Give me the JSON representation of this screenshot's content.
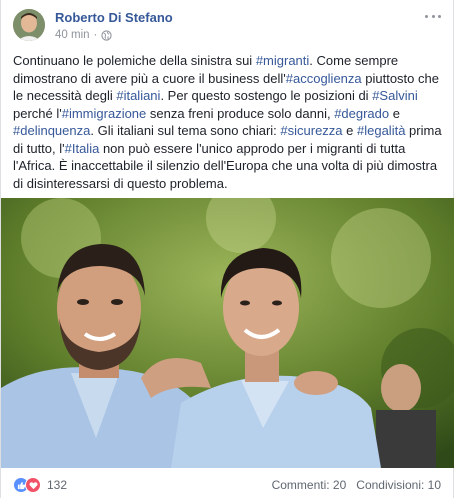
{
  "post": {
    "author": "Roberto Di Stefano",
    "time": "40 min",
    "separator": "·",
    "privacy_icon": "globe-icon",
    "menu_icon": "more-options-icon",
    "text_segments": [
      {
        "t": "Continuano le polemiche della sinistra sui ",
        "tag": false
      },
      {
        "t": "#migranti",
        "tag": true
      },
      {
        "t": ". Come sempre dimostrano di avere più a cuore il business dell'",
        "tag": false
      },
      {
        "t": "#accoglienza",
        "tag": true
      },
      {
        "t": " piuttosto che le necessità degli ",
        "tag": false
      },
      {
        "t": "#italiani",
        "tag": true
      },
      {
        "t": ". Per questo sostengo le posizioni di ",
        "tag": false
      },
      {
        "t": "#Salvini",
        "tag": true
      },
      {
        "t": " perché l'",
        "tag": false
      },
      {
        "t": "#immigrazione",
        "tag": true
      },
      {
        "t": " senza freni produce solo danni, ",
        "tag": false
      },
      {
        "t": "#degrado",
        "tag": true
      },
      {
        "t": " e ",
        "tag": false
      },
      {
        "t": "#delinquenza",
        "tag": true
      },
      {
        "t": ". Gli italiani sul tema sono chiari: ",
        "tag": false
      },
      {
        "t": "#sicurezza",
        "tag": true
      },
      {
        "t": " e ",
        "tag": false
      },
      {
        "t": "#legalità",
        "tag": true
      },
      {
        "t": " prima di tutto, l'",
        "tag": false
      },
      {
        "t": "#Italia",
        "tag": true
      },
      {
        "t": " non può essere l'unico approdo per i migranti di tutta l'Africa. È inaccettabile il silenzio dell'Europa che una volta di più dimostra di disinteressarsi di questo problema.",
        "tag": false
      }
    ]
  },
  "footer": {
    "reaction_icons": [
      "like-reaction-icon",
      "love-reaction-icon"
    ],
    "reaction_count": "132",
    "comments": "Commenti: 20",
    "shares": "Condivisioni: 10"
  },
  "colors": {
    "link": "#365899",
    "text": "#1d2129",
    "meta": "#90949c",
    "like": "#5890ff",
    "love": "#f25268"
  }
}
